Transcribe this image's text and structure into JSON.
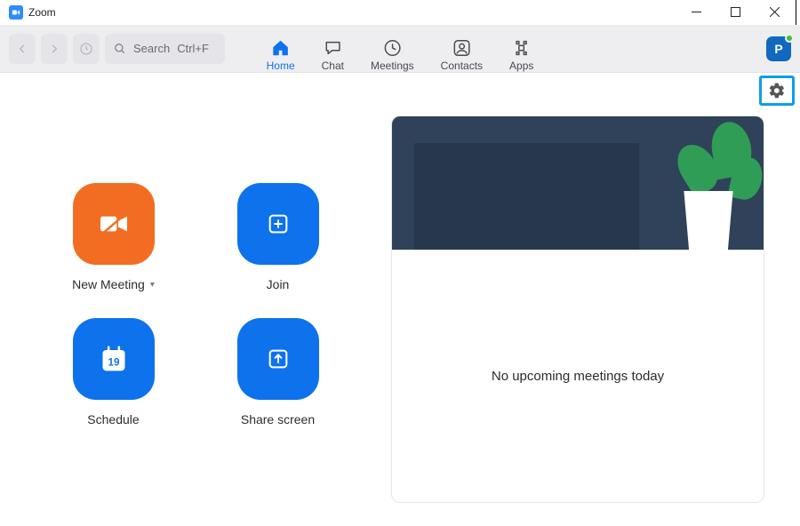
{
  "window": {
    "title": "Zoom"
  },
  "toolbar": {
    "search_label": "Search",
    "search_hint": "Ctrl+F"
  },
  "tabs": {
    "home": "Home",
    "chat": "Chat",
    "meetings": "Meetings",
    "contacts": "Contacts",
    "apps": "Apps",
    "active": "home"
  },
  "profile": {
    "initial": "P",
    "status": "available"
  },
  "actions": {
    "new_meeting": "New Meeting",
    "join": "Join",
    "schedule": "Schedule",
    "schedule_day": "19",
    "share_screen": "Share screen"
  },
  "side_panel": {
    "empty_message": "No upcoming meetings today"
  },
  "colors": {
    "accent_blue": "#0e72ed",
    "accent_orange": "#f26d21"
  }
}
